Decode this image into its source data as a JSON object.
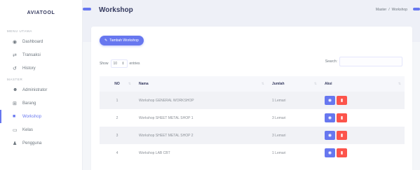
{
  "app": {
    "brand": "AVIATOOL"
  },
  "sidebar": {
    "header_main": "MENU UTAMA",
    "header_master": "MASTER",
    "items": [
      {
        "label": "Dashboard",
        "icon": "gauge-icon"
      },
      {
        "label": "Transaksi",
        "icon": "transfer-icon"
      },
      {
        "label": "History",
        "icon": "history-icon"
      },
      {
        "label": "Administrator",
        "icon": "users-icon"
      },
      {
        "label": "Barang",
        "icon": "sitemap-icon"
      },
      {
        "label": "Workshop",
        "icon": "workshop-icon",
        "active": true
      },
      {
        "label": "Kelas",
        "icon": "class-icon"
      },
      {
        "label": "Pengguna",
        "icon": "user-icon"
      }
    ]
  },
  "header": {
    "title": "Workshop",
    "breadcrumb": [
      "Master",
      "Workshop"
    ]
  },
  "toolbar": {
    "add_label": "Tambah Workshop"
  },
  "table_controls": {
    "show_label": "Show",
    "entries_value": "10",
    "entries_label": "entries",
    "search_label": "Search:",
    "search_value": ""
  },
  "table": {
    "columns": [
      "NO",
      "Nama",
      "Jumlah",
      "Aksi"
    ],
    "rows": [
      {
        "no": "1",
        "nama": "Workshop GENERAL WORKSHOP",
        "jumlah": "1 Lemari"
      },
      {
        "no": "2",
        "nama": "Workshop SHEET METAL SHOP 1",
        "jumlah": "3 Lemari"
      },
      {
        "no": "3",
        "nama": "Workshop SHEET METAL SHOP 2",
        "jumlah": "3 Lemari"
      },
      {
        "no": "4",
        "nama": "Workshop LAB CBT",
        "jumlah": "1 Lemari"
      }
    ]
  },
  "colors": {
    "primary": "#6777ef",
    "danger": "#fc544b",
    "heading": "#34395e"
  }
}
